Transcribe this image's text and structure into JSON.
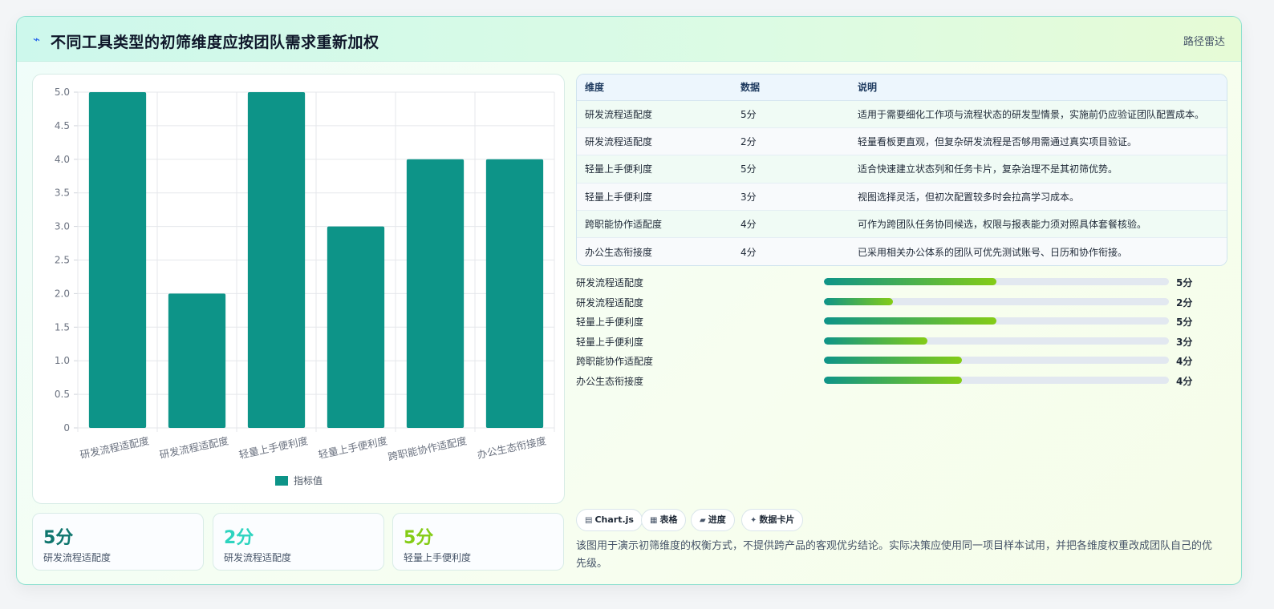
{
  "header": {
    "icon": "lightning-icon",
    "title": "不同工具类型的初筛维度应按团队需求重新加权",
    "tag": "路径雷达"
  },
  "chart_data": {
    "type": "bar",
    "categories": [
      "研发流程适配度",
      "研发流程适配度",
      "轻量上手便利度",
      "轻量上手便利度",
      "跨职能协作适配度",
      "办公生态衔接度"
    ],
    "series": [
      {
        "name": "指标值",
        "values": [
          5,
          2,
          5,
          3,
          4,
          4
        ]
      }
    ],
    "ylim": [
      0,
      5
    ],
    "yticks": [
      "0",
      "0.5",
      "1.0",
      "1.5",
      "2.0",
      "2.5",
      "3.0",
      "3.5",
      "4.0",
      "4.5",
      "5.0"
    ],
    "grid": true,
    "legend": "bottom",
    "color": "#0d9488"
  },
  "stats": [
    {
      "value": "5分",
      "label": "研发流程适配度",
      "color": "#0f766e"
    },
    {
      "value": "2分",
      "label": "研发流程适配度",
      "color": "#2dd4bf"
    },
    {
      "value": "5分",
      "label": "轻量上手便利度",
      "color": "#84cc16"
    }
  ],
  "table": {
    "headers": [
      "维度",
      "数据",
      "说明"
    ],
    "rows": [
      [
        "研发流程适配度",
        "5分",
        "适用于需要细化工作项与流程状态的研发型情景，实施前仍应验证团队配置成本。"
      ],
      [
        "研发流程适配度",
        "2分",
        "轻量看板更直观，但复杂研发流程是否够用需通过真实项目验证。"
      ],
      [
        "轻量上手便利度",
        "5分",
        "适合快速建立状态列和任务卡片，复杂治理不是其初筛优势。"
      ],
      [
        "轻量上手便利度",
        "3分",
        "视图选择灵活，但初次配置较多时会拉高学习成本。"
      ],
      [
        "跨职能协作适配度",
        "4分",
        "可作为跨团队任务协同候选，权限与报表能力须对照具体套餐核验。"
      ],
      [
        "办公生态衔接度",
        "4分",
        "已采用相关办公体系的团队可优先测试账号、日历和协作衔接。"
      ]
    ]
  },
  "progress": [
    {
      "label": "研发流程适配度",
      "value": 5,
      "text": "5分"
    },
    {
      "label": "研发流程适配度",
      "value": 2,
      "text": "2分"
    },
    {
      "label": "轻量上手便利度",
      "value": 5,
      "text": "5分"
    },
    {
      "label": "轻量上手便利度",
      "value": 3,
      "text": "3分"
    },
    {
      "label": "跨职能协作适配度",
      "value": 4,
      "text": "4分"
    },
    {
      "label": "办公生态衔接度",
      "value": 4,
      "text": "4分"
    }
  ],
  "progress_max": 10,
  "chips": [
    {
      "icon": "chart-icon",
      "glyph": "▤",
      "label": "Chart.js"
    },
    {
      "icon": "table-icon",
      "glyph": "▦",
      "label": "表格"
    },
    {
      "icon": "progress-icon",
      "glyph": "▰",
      "label": "进度"
    },
    {
      "icon": "sparkle-icon",
      "glyph": "✦",
      "label": "数据卡片"
    }
  ],
  "note": "该图用于演示初筛维度的权衡方式，不提供跨产品的客观优劣结论。实际决策应使用同一项目样本试用，并把各维度权重改成团队自己的优先级。"
}
